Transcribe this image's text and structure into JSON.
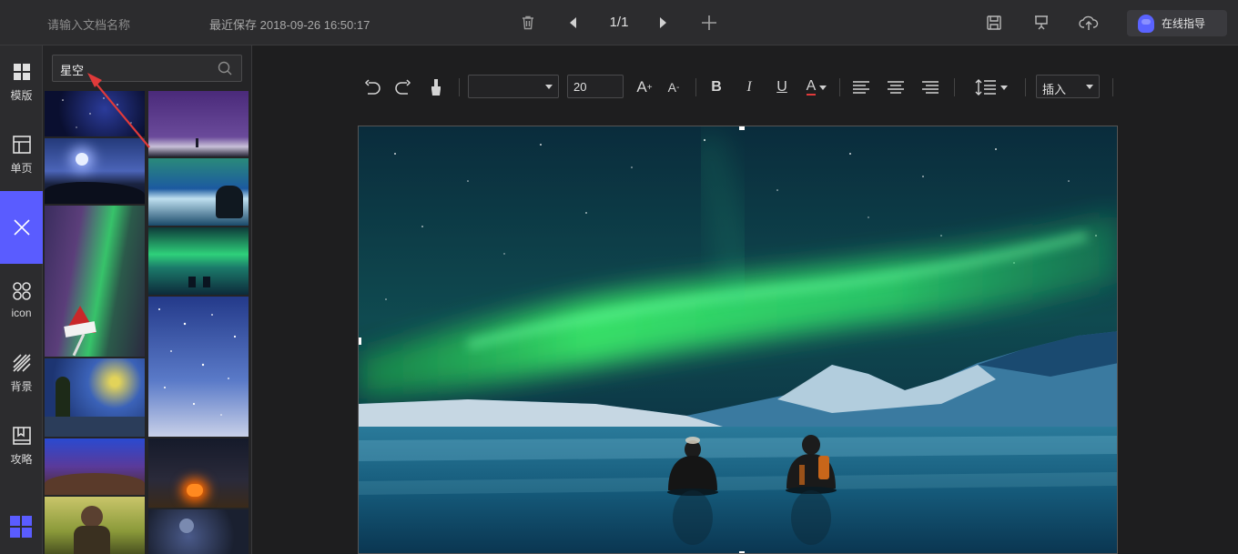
{
  "header": {
    "doc_name_placeholder": "请输入文档名称",
    "last_saved": "最近保存 2018-09-26 16:50:17",
    "page_indicator": "1/1",
    "help_label": "在线指导"
  },
  "rail": {
    "items": [
      {
        "label": "模版",
        "icon": "template-grid-icon"
      },
      {
        "label": "单页",
        "icon": "single-page-icon"
      },
      {
        "label": "",
        "icon": "close-icon",
        "active": true
      },
      {
        "label": "icon",
        "icon": "icon-library-icon"
      },
      {
        "label": "背景",
        "icon": "background-stripes-icon"
      },
      {
        "label": "攻略",
        "icon": "guide-book-icon"
      }
    ]
  },
  "panel": {
    "search_value": "星空"
  },
  "toolbar": {
    "font_size": "20",
    "insert_label": "插入",
    "bold": "B",
    "italic": "I",
    "underline": "U",
    "font_color": "A",
    "grow": "A",
    "shrink": "A"
  },
  "colors": {
    "accent": "#5a5cff",
    "topbar": "#2c2c2e",
    "background": "#1e1e1f",
    "arrow": "#e03a3a"
  }
}
